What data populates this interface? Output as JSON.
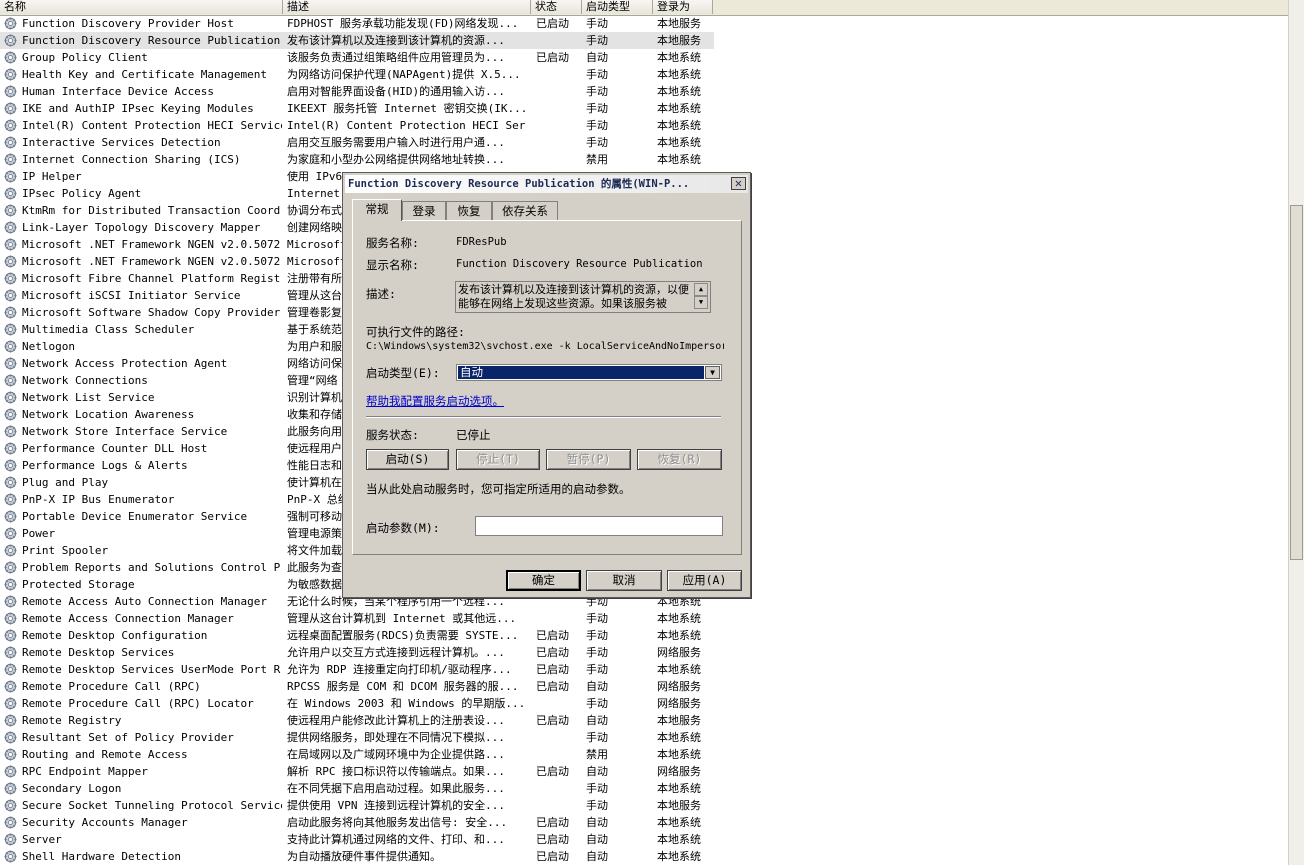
{
  "columns": {
    "name": "名称",
    "desc": "描述",
    "status": "状态",
    "startup": "启动类型",
    "logon": "登录为"
  },
  "rows": [
    {
      "name": "Function Discovery Provider Host",
      "desc": "FDPHOST 服务承载功能发现(FD)网络发现...",
      "status": "已启动",
      "startup": "手动",
      "logon": "本地服务"
    },
    {
      "name": "Function Discovery Resource Publication",
      "desc": "发布该计算机以及连接到该计算机的资源...",
      "status": "",
      "startup": "手动",
      "logon": "本地服务"
    },
    {
      "name": "Group Policy Client",
      "desc": "该服务负责通过组策略组件应用管理员为...",
      "status": "已启动",
      "startup": "自动",
      "logon": "本地系统"
    },
    {
      "name": "Health Key and Certificate Management",
      "desc": "为网络访问保护代理(NAPAgent)提供 X.5...",
      "status": "",
      "startup": "手动",
      "logon": "本地系统"
    },
    {
      "name": "Human Interface Device Access",
      "desc": "启用对智能界面设备(HID)的通用输入访...",
      "status": "",
      "startup": "手动",
      "logon": "本地系统"
    },
    {
      "name": "IKE and AuthIP IPsec Keying Modules",
      "desc": "IKEEXT 服务托管 Internet 密钥交换(IK...",
      "status": "",
      "startup": "手动",
      "logon": "本地系统"
    },
    {
      "name": "Intel(R) Content Protection HECI Service",
      "desc": "Intel(R) Content Protection HECI Ser...",
      "status": "",
      "startup": "手动",
      "logon": "本地系统"
    },
    {
      "name": "Interactive Services Detection",
      "desc": "启用交互服务需要用户输入时进行用户通...",
      "status": "",
      "startup": "手动",
      "logon": "本地系统"
    },
    {
      "name": "Internet Connection Sharing (ICS)",
      "desc": "为家庭和小型办公网络提供网络地址转换...",
      "status": "",
      "startup": "禁用",
      "logon": "本地系统"
    },
    {
      "name": "IP Helper",
      "desc": "使用 IPv6",
      "status": "",
      "startup": "",
      "logon": ""
    },
    {
      "name": "IPsec Policy Agent",
      "desc": "Internet",
      "status": "",
      "startup": "",
      "logon": ""
    },
    {
      "name": "KtmRm for Distributed Transaction Coord...",
      "desc": "协调分布式",
      "status": "",
      "startup": "",
      "logon": ""
    },
    {
      "name": "Link-Layer Topology Discovery Mapper",
      "desc": "创建网络映",
      "status": "",
      "startup": "",
      "logon": ""
    },
    {
      "name": "Microsoft .NET Framework NGEN v2.0.5072...",
      "desc": "Microsoft",
      "status": "",
      "startup": "",
      "logon": ""
    },
    {
      "name": "Microsoft .NET Framework NGEN v2.0.5072...",
      "desc": "Microsoft",
      "status": "",
      "startup": "",
      "logon": ""
    },
    {
      "name": "Microsoft Fibre Channel Platform Regist...",
      "desc": "注册带有所",
      "status": "",
      "startup": "",
      "logon": ""
    },
    {
      "name": "Microsoft iSCSI Initiator Service",
      "desc": "管理从这台",
      "status": "",
      "startup": "",
      "logon": ""
    },
    {
      "name": "Microsoft Software Shadow Copy Provider",
      "desc": "管理卷影复",
      "status": "",
      "startup": "",
      "logon": ""
    },
    {
      "name": "Multimedia Class Scheduler",
      "desc": "基于系统范",
      "status": "",
      "startup": "",
      "logon": ""
    },
    {
      "name": "Netlogon",
      "desc": "为用户和服",
      "status": "",
      "startup": "",
      "logon": ""
    },
    {
      "name": "Network Access Protection Agent",
      "desc": "网络访问保",
      "status": "",
      "startup": "",
      "logon": ""
    },
    {
      "name": "Network Connections",
      "desc": "管理“网络",
      "status": "",
      "startup": "",
      "logon": ""
    },
    {
      "name": "Network List Service",
      "desc": "识别计算机",
      "status": "",
      "startup": "",
      "logon": ""
    },
    {
      "name": "Network Location Awareness",
      "desc": "收集和存储",
      "status": "",
      "startup": "",
      "logon": ""
    },
    {
      "name": "Network Store Interface Service",
      "desc": "此服务向用",
      "status": "",
      "startup": "",
      "logon": ""
    },
    {
      "name": "Performance Counter DLL Host",
      "desc": "使远程用户",
      "status": "",
      "startup": "",
      "logon": ""
    },
    {
      "name": "Performance Logs & Alerts",
      "desc": "性能日志和",
      "status": "",
      "startup": "",
      "logon": ""
    },
    {
      "name": "Plug and Play",
      "desc": "使计算机在",
      "status": "",
      "startup": "",
      "logon": ""
    },
    {
      "name": "PnP-X IP Bus Enumerator",
      "desc": "PnP-X 总线",
      "status": "",
      "startup": "",
      "logon": ""
    },
    {
      "name": "Portable Device Enumerator Service",
      "desc": "强制可移动",
      "status": "",
      "startup": "",
      "logon": ""
    },
    {
      "name": "Power",
      "desc": "管理电源策",
      "status": "",
      "startup": "",
      "logon": ""
    },
    {
      "name": "Print Spooler",
      "desc": "将文件加载",
      "status": "",
      "startup": "",
      "logon": ""
    },
    {
      "name": "Problem Reports and Solutions Control P...",
      "desc": "此服务为查",
      "status": "",
      "startup": "",
      "logon": ""
    },
    {
      "name": "Protected Storage",
      "desc": "为敏感数据",
      "status": "",
      "startup": "",
      "logon": ""
    },
    {
      "name": "Remote Access Auto Connection Manager",
      "desc": "无论什么时候，当某个程序引用一个远程...",
      "status": "",
      "startup": "手动",
      "logon": "本地系统"
    },
    {
      "name": "Remote Access Connection Manager",
      "desc": "管理从这台计算机到 Internet 或其他远...",
      "status": "",
      "startup": "手动",
      "logon": "本地系统"
    },
    {
      "name": "Remote Desktop Configuration",
      "desc": "远程桌面配置服务(RDCS)负责需要 SYSTE...",
      "status": "已启动",
      "startup": "手动",
      "logon": "本地系统"
    },
    {
      "name": "Remote Desktop Services",
      "desc": "允许用户以交互方式连接到远程计算机。...",
      "status": "已启动",
      "startup": "手动",
      "logon": "网络服务"
    },
    {
      "name": "Remote Desktop Services UserMode Port R...",
      "desc": "允许为 RDP 连接重定向打印机/驱动程序...",
      "status": "已启动",
      "startup": "手动",
      "logon": "本地系统"
    },
    {
      "name": "Remote Procedure Call (RPC)",
      "desc": "RPCSS 服务是 COM 和 DCOM 服务器的服...",
      "status": "已启动",
      "startup": "自动",
      "logon": "网络服务"
    },
    {
      "name": "Remote Procedure Call (RPC) Locator",
      "desc": "在 Windows 2003 和 Windows 的早期版...",
      "status": "",
      "startup": "手动",
      "logon": "网络服务"
    },
    {
      "name": "Remote Registry",
      "desc": "使远程用户能修改此计算机上的注册表设...",
      "status": "已启动",
      "startup": "自动",
      "logon": "本地服务"
    },
    {
      "name": "Resultant Set of Policy Provider",
      "desc": "提供网络服务，即处理在不同情况下模拟...",
      "status": "",
      "startup": "手动",
      "logon": "本地系统"
    },
    {
      "name": "Routing and Remote Access",
      "desc": "在局域网以及广域网环境中为企业提供路...",
      "status": "",
      "startup": "禁用",
      "logon": "本地系统"
    },
    {
      "name": "RPC Endpoint Mapper",
      "desc": "解析 RPC 接口标识符以传输端点。如果...",
      "status": "已启动",
      "startup": "自动",
      "logon": "网络服务"
    },
    {
      "name": "Secondary Logon",
      "desc": "在不同凭据下启用启动过程。如果此服务...",
      "status": "",
      "startup": "手动",
      "logon": "本地系统"
    },
    {
      "name": "Secure Socket Tunneling Protocol Service",
      "desc": "提供使用 VPN 连接到远程计算机的安全...",
      "status": "",
      "startup": "手动",
      "logon": "本地服务"
    },
    {
      "name": "Security Accounts Manager",
      "desc": "启动此服务将向其他服务发出信号: 安全...",
      "status": "已启动",
      "startup": "自动",
      "logon": "本地系统"
    },
    {
      "name": "Server",
      "desc": "支持此计算机通过网络的文件、打印、和...",
      "status": "已启动",
      "startup": "自动",
      "logon": "本地系统"
    },
    {
      "name": "Shell Hardware Detection",
      "desc": "为自动播放硬件事件提供通知。",
      "status": "已启动",
      "startup": "自动",
      "logon": "本地系统"
    }
  ],
  "selected_index": 1,
  "dialog": {
    "title": "Function Discovery Resource Publication 的属性(WIN-P...",
    "close": "✕",
    "tabs": [
      "常规",
      "登录",
      "恢复",
      "依存关系"
    ],
    "service_name_label": "服务名称:",
    "service_name": "FDResPub",
    "display_name_label": "显示名称:",
    "display_name": "Function Discovery Resource Publication",
    "desc_label": "描述:",
    "description": "发布该计算机以及连接到该计算机的资源，以便能够在网络上发现这些资源。如果该服务被",
    "path_label": "可执行文件的路径:",
    "path": "C:\\Windows\\system32\\svchost.exe -k LocalServiceAndNoImpersor",
    "startup_type_label": "启动类型(E):",
    "startup_type": "自动",
    "help_link": "帮助我配置服务启动选项。",
    "status_label": "服务状态:",
    "status_value": "已停止",
    "btn_start": "启动(S)",
    "btn_stop": "停止(T)",
    "btn_pause": "暂停(P)",
    "btn_resume": "恢复(R)",
    "hint": "当从此处启动服务时，您可指定所适用的启动参数。",
    "params_label": "启动参数(M):",
    "params_value": "",
    "ok": "确定",
    "cancel": "取消",
    "apply": "应用(A)"
  }
}
